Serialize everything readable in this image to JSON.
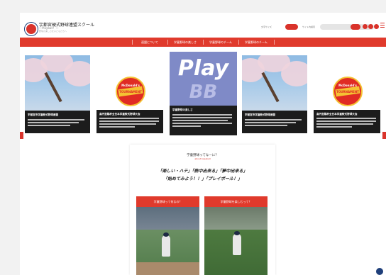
{
  "header": {
    "logo_title": "宇都宮硬式野球連盟スクール",
    "logo_sub": "～Playball！～",
    "logo_note": "野球の楽しさを子どもたちへ"
  },
  "utility": {
    "label_left": "文字サイズ",
    "label_right": "サイト内検索"
  },
  "nav": {
    "items": [
      "連盟について",
      "学童野球の楽しさ",
      "学童野球のチーム",
      "学童野球のチーム"
    ]
  },
  "carousel": {
    "cards": [
      {
        "kind": "photo",
        "title": "宇都宮市学童軟式野球連盟",
        "lines": 3
      },
      {
        "kind": "badge",
        "badge_line1": "McDonald's",
        "badge_line2": "TOURNAMENT",
        "title": "高円宮賜杯全日本学童軟式野球大会",
        "lines": 4
      },
      {
        "kind": "play",
        "play_word": "Play",
        "play_bb": "BB",
        "title": "学童野球の楽しさ",
        "lines": 5
      },
      {
        "kind": "photo",
        "title": "宇都宮市学童軟式野球連盟",
        "lines": 3
      },
      {
        "kind": "badge",
        "badge_line1": "McDonald's",
        "badge_line2": "TOURNAMENT",
        "title": "高円宮賜杯全日本学童軟式野球大会",
        "lines": 4
      }
    ]
  },
  "feature": {
    "title": "学童野球ってなーに？",
    "subtitle": "about baseball",
    "line1": "「楽しい・ハテ」「熱中出来る」「夢中出来る」",
    "line2": "「始めてみよう！！」「プレイボール！」",
    "tiles": [
      {
        "label": "学童野球って何なの？"
      },
      {
        "label": "学童野球を楽しむって？"
      }
    ]
  },
  "colors": {
    "accent": "#e03a2c",
    "navy": "#1f3f7a"
  }
}
